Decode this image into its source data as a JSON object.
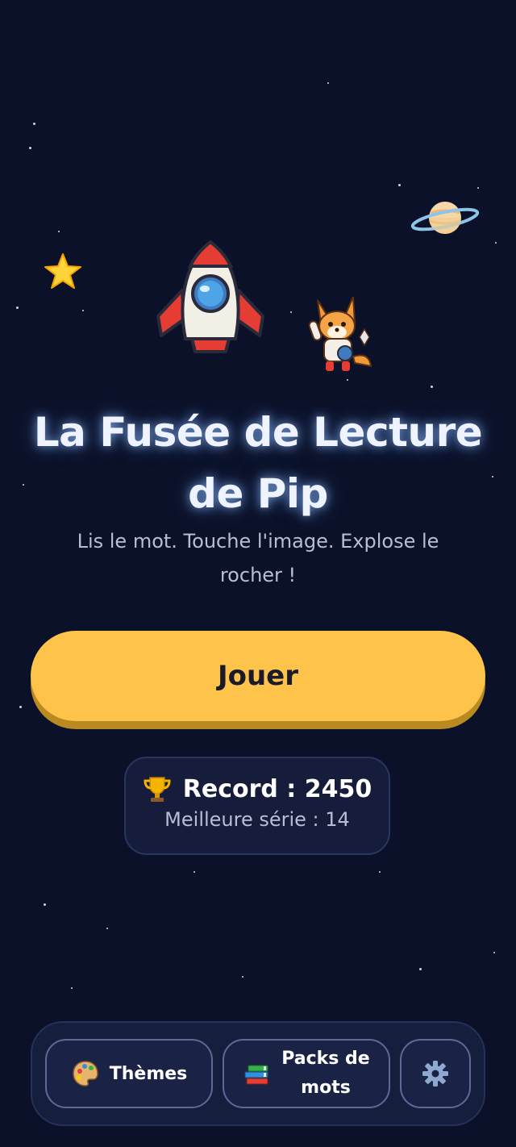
{
  "app": {
    "title": "La Fusée de Lecture de Pip",
    "subtitle": "Lis le mot. Touche l'image. Explose le rocher !"
  },
  "play": {
    "label": "Jouer"
  },
  "record": {
    "label": "Record : 2450",
    "best_streak": "Meilleure série : 14"
  },
  "nav": {
    "themes_label": "Thèmes",
    "packs_label": "Packs de mots",
    "settings_icon": "gear-icon"
  },
  "icons": {
    "decor": [
      "star-icon",
      "planet-icon",
      "rocket-icon",
      "fox-astronaut-icon"
    ],
    "record": "trophy-icon",
    "themes": "palette-icon",
    "packs": "books-icon"
  },
  "colors": {
    "background": "#0b1128",
    "play_button": "#fdc34a",
    "card": "#151d3b",
    "accent_glow": "#8cbeff"
  }
}
